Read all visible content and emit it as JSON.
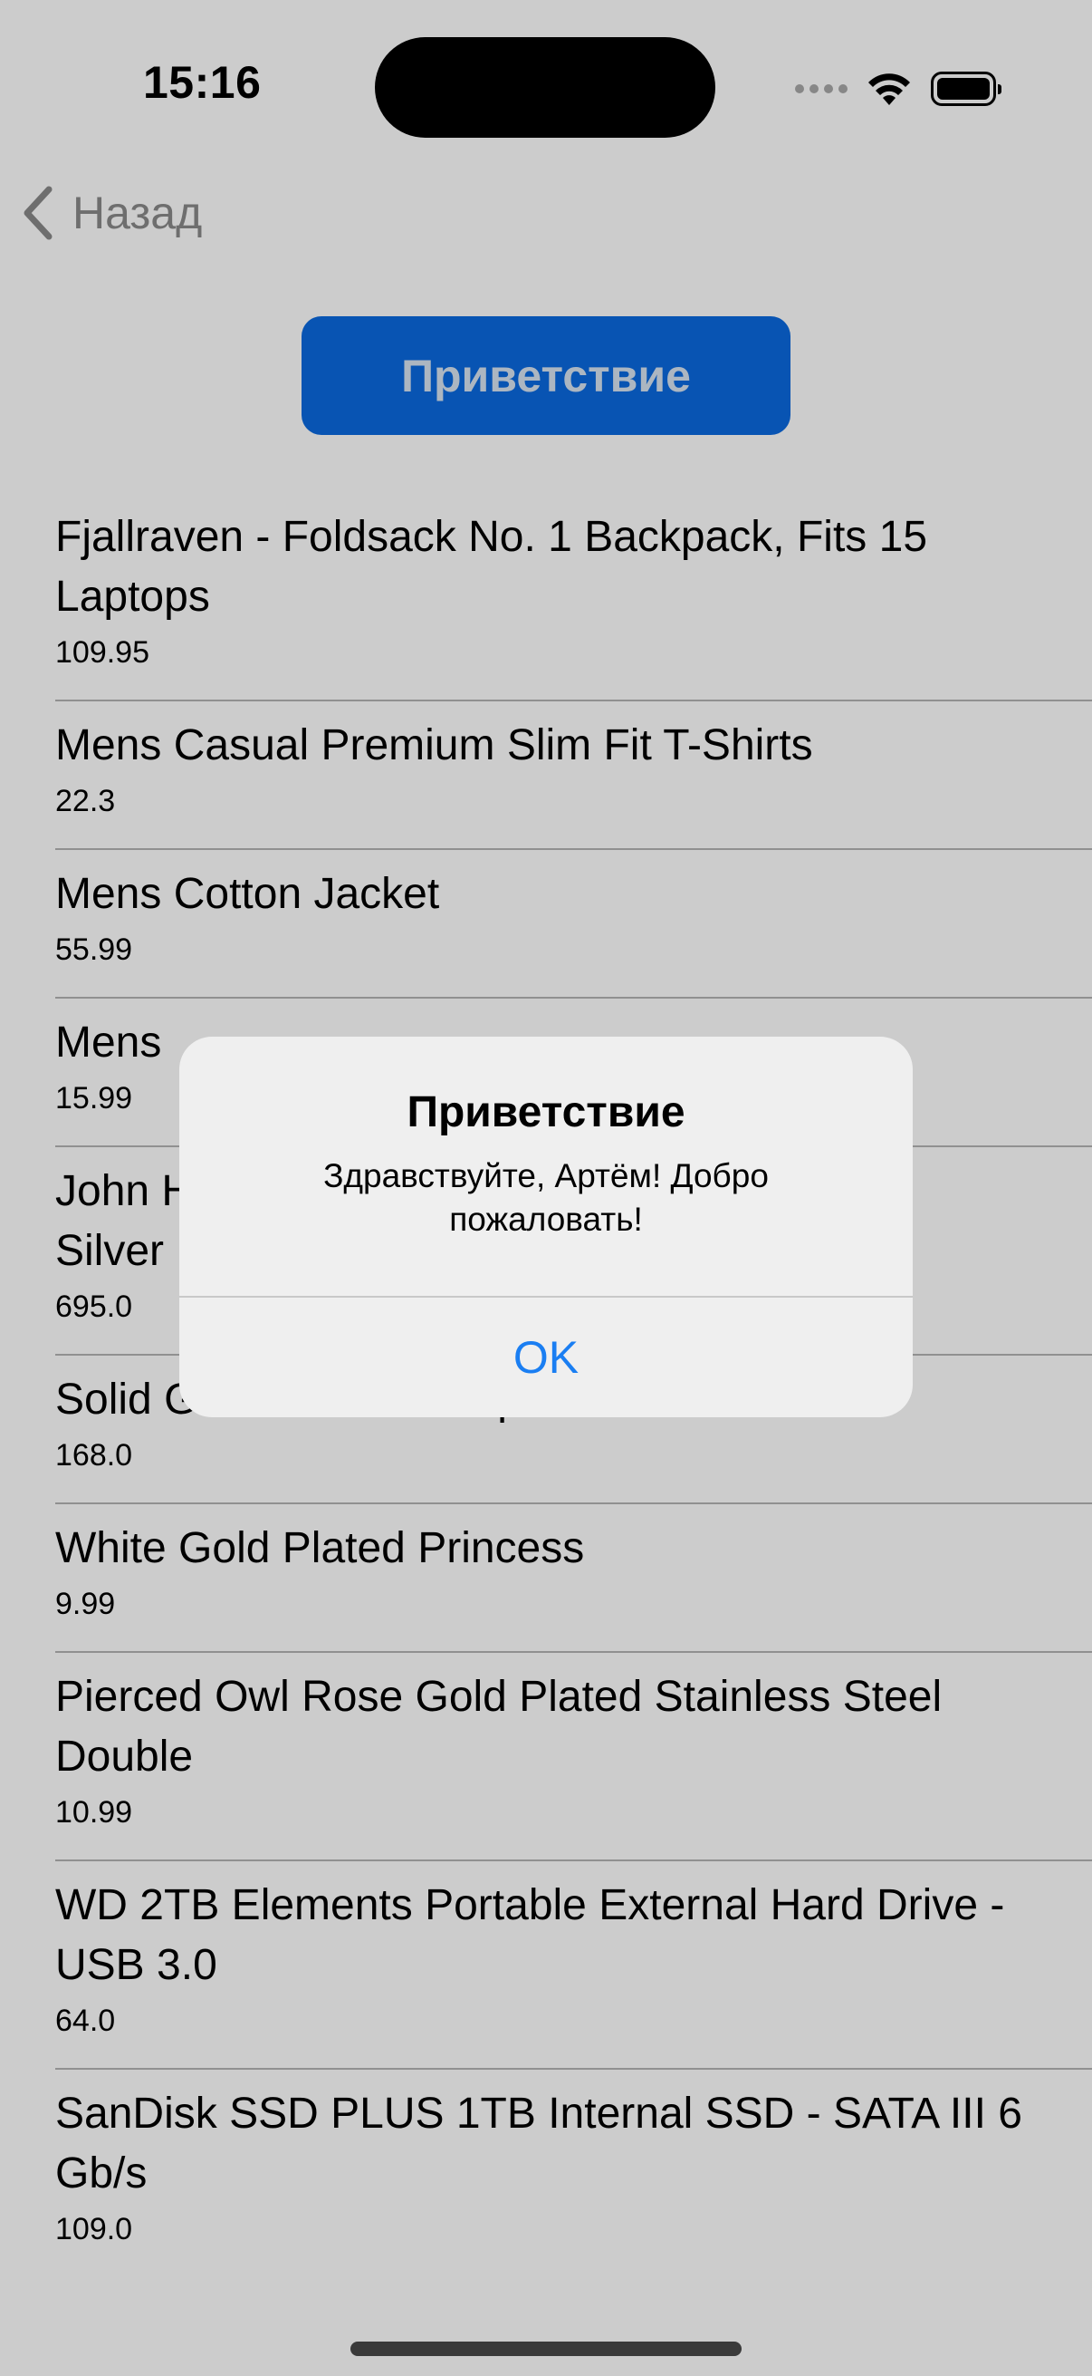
{
  "status_bar": {
    "time": "15:16"
  },
  "nav": {
    "back_label": "Назад"
  },
  "greet_button_label": "Приветствие",
  "products": [
    {
      "title": "Fjallraven - Foldsack No. 1 Backpack, Fits 15 Laptops",
      "price": "109.95"
    },
    {
      "title": "Mens Casual Premium Slim Fit T-Shirts",
      "price": "22.3"
    },
    {
      "title": "Mens Cotton Jacket",
      "price": "55.99"
    },
    {
      "title": "Mens",
      "price": "15.99"
    },
    {
      "title": "John H &\nSilver",
      "price": "695.0"
    },
    {
      "title": "Solid Gold Petite Micropave",
      "price": "168.0"
    },
    {
      "title": "White Gold Plated Princess",
      "price": "9.99"
    },
    {
      "title": "Pierced Owl Rose Gold Plated Stainless Steel Double",
      "price": "10.99"
    },
    {
      "title": "WD 2TB Elements Portable External Hard Drive - USB 3.0",
      "price": "64.0"
    },
    {
      "title": "SanDisk SSD PLUS 1TB Internal SSD - SATA III 6 Gb/s",
      "price": "109.0"
    }
  ],
  "alert": {
    "title": "Приветствие",
    "message": "Здравствуйте, Артём! Добро пожаловать!",
    "ok_label": "OK"
  },
  "colors": {
    "accent": "#0a6ae0",
    "alert_button": "#1a7ef2"
  }
}
